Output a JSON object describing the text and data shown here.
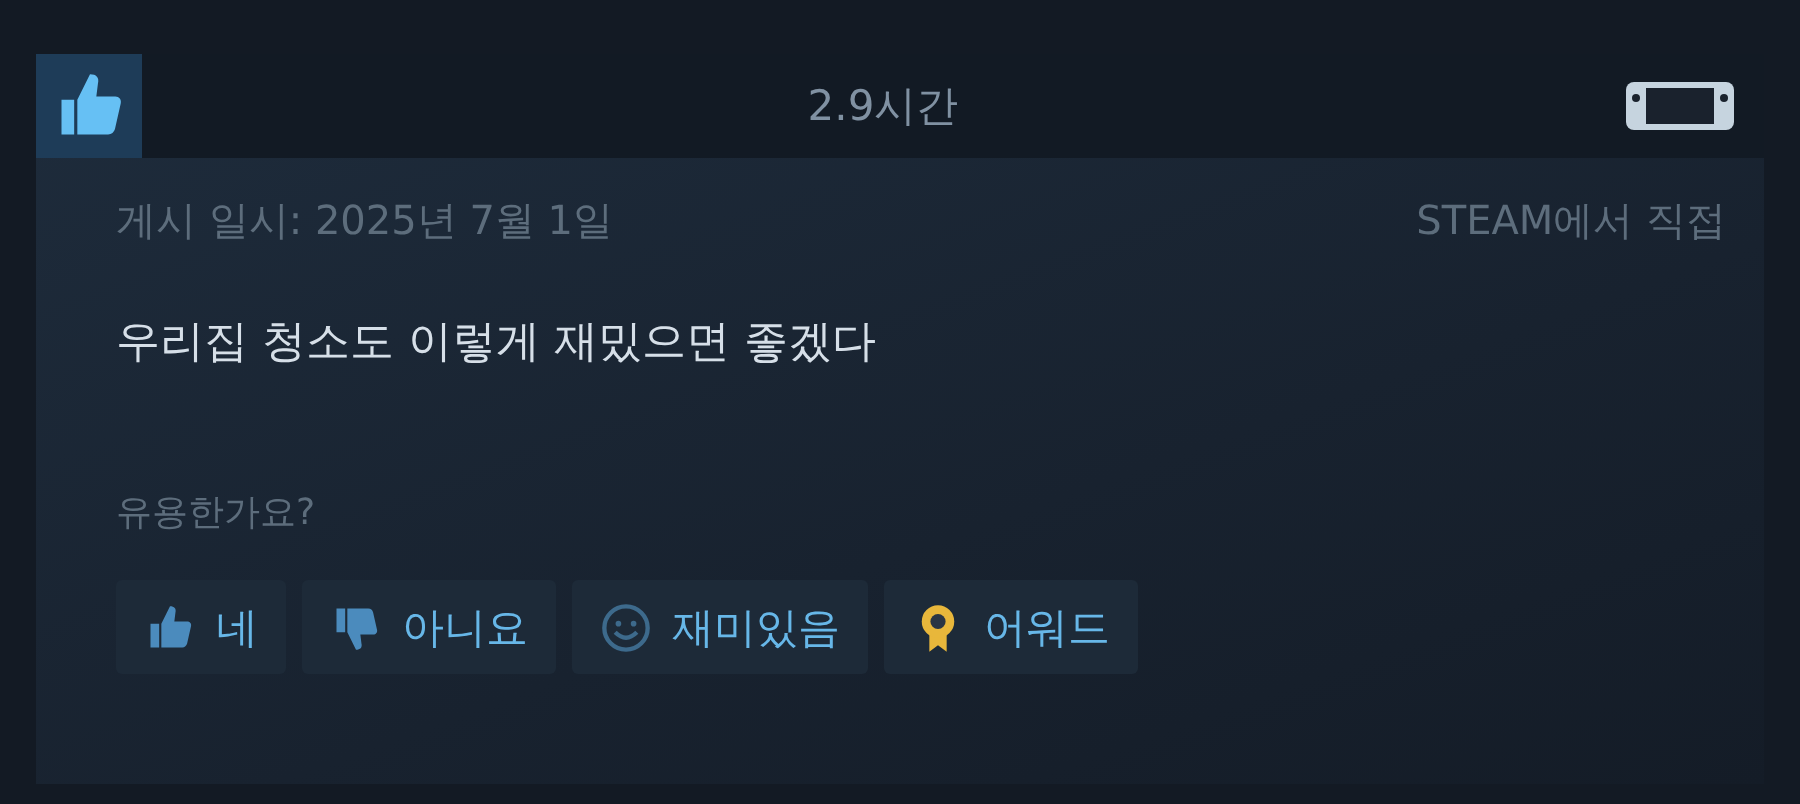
{
  "review": {
    "recommended": true,
    "playtime": "2.9시간",
    "posted": "게시 일시: 2025년 7월 1일",
    "source": "STEAM에서 직접",
    "text": "우리집 청소도 이렇게 재밌으면 좋겠다",
    "helpful_prompt": "유용한가요?"
  },
  "buttons": [
    {
      "kind": "yes",
      "label": "네"
    },
    {
      "kind": "no",
      "label": "아니요"
    },
    {
      "kind": "funny",
      "label": "재미있음"
    },
    {
      "kind": "award",
      "label": "어워드"
    }
  ]
}
